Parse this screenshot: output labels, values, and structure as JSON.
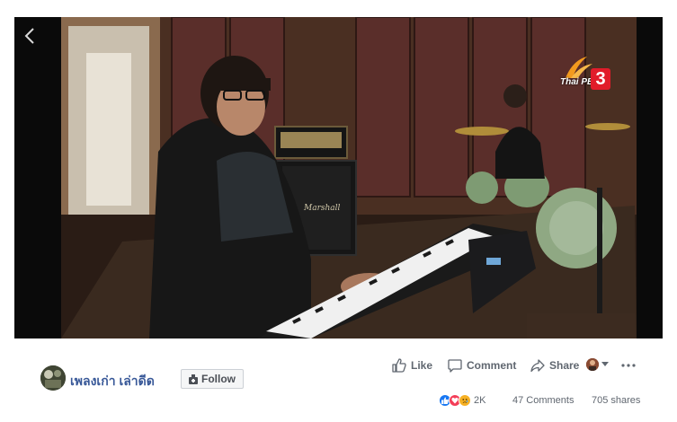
{
  "post": {
    "page_name": "เพลงเก่า เล่าดีด",
    "follow_label": "Follow",
    "actions": {
      "like_label": "Like",
      "comment_label": "Comment",
      "share_label": "Share"
    },
    "stats": {
      "reactions_count": "2K",
      "comments": "47 Comments",
      "shares": "705 shares"
    },
    "reaction_icons": [
      "like-reaction",
      "love-reaction",
      "sad-reaction"
    ]
  },
  "video": {
    "channel_logo_text": "Thai PBS",
    "channel_logo_number": "3",
    "back_icon": "chevron-left-icon"
  },
  "colors": {
    "link": "#385898",
    "muted": "#606770",
    "like_blue": "#1877f2",
    "love_red": "#f33e58",
    "sad_yellow": "#f7b125",
    "logo_red": "#e11c2a"
  }
}
